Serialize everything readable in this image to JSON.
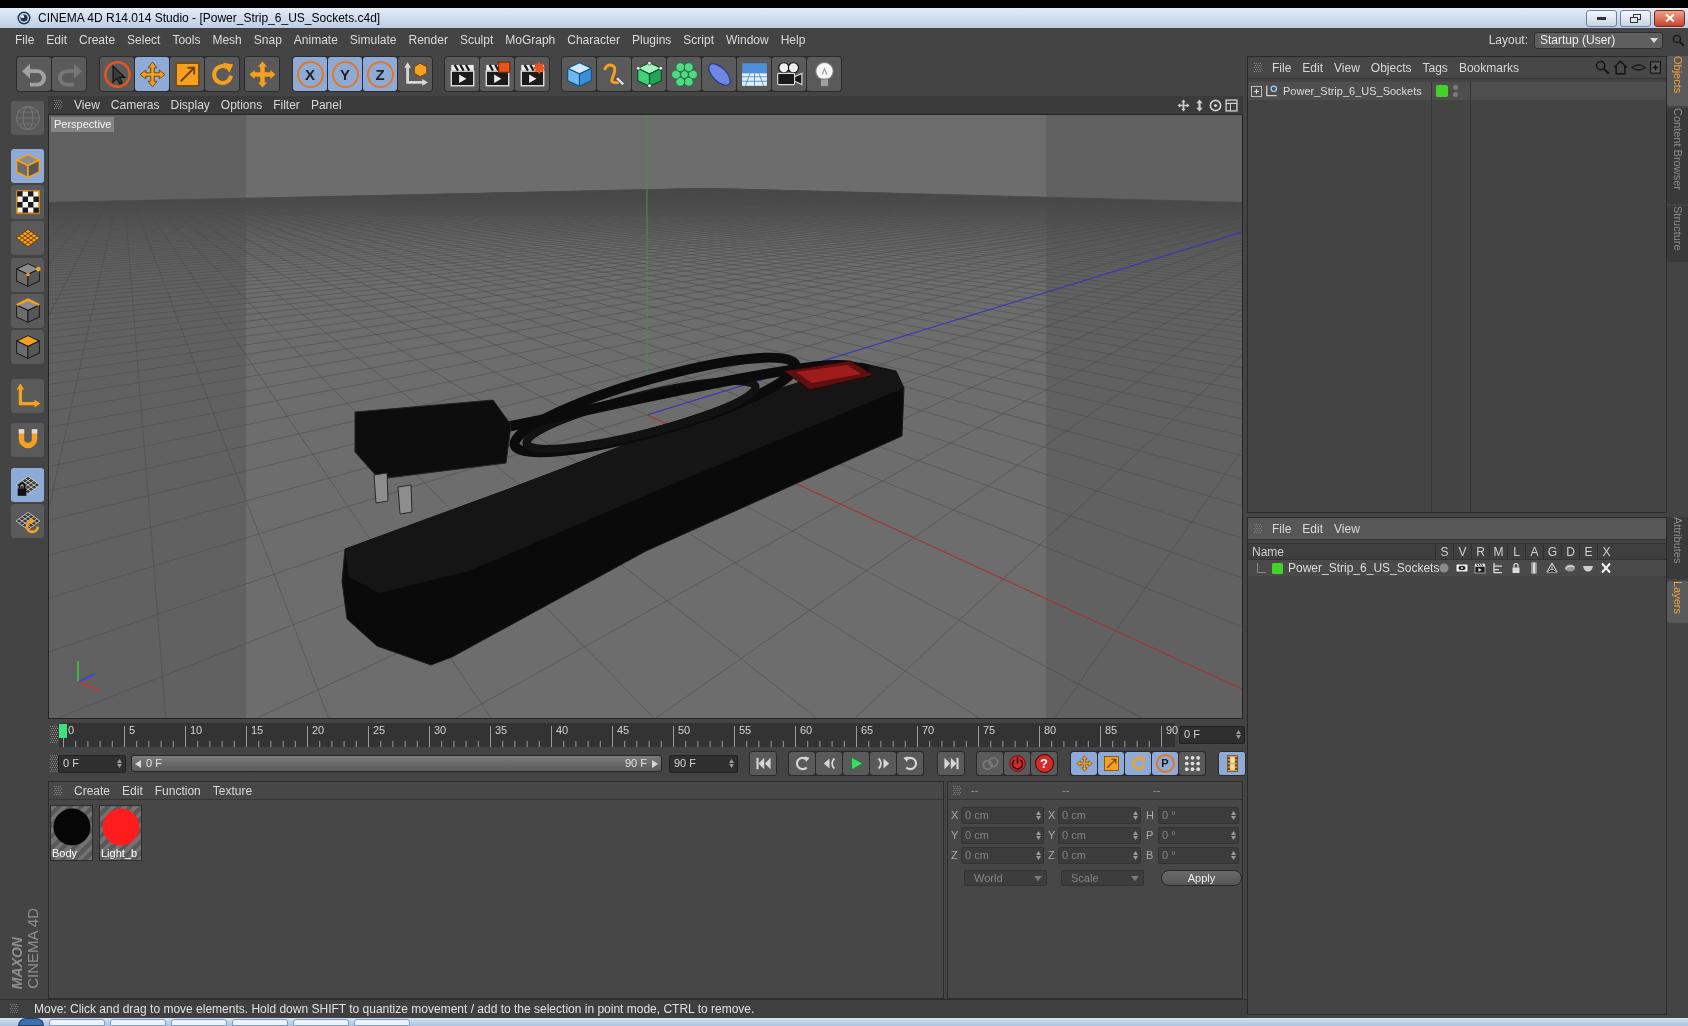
{
  "window": {
    "title": "CINEMA 4D R14.014 Studio - [Power_Strip_6_US_Sockets.c4d]"
  },
  "menu_bar": {
    "items": [
      "File",
      "Edit",
      "Create",
      "Select",
      "Tools",
      "Mesh",
      "Snap",
      "Animate",
      "Simulate",
      "Render",
      "Sculpt",
      "MoGraph",
      "Character",
      "Plugins",
      "Script",
      "Window",
      "Help"
    ],
    "layout_label": "Layout:",
    "layout_value": "Startup (User)"
  },
  "toolbar": {
    "groups": [
      [
        {
          "disabled": false
        },
        {
          "disabled": true
        }
      ],
      [
        {
          "selected": false
        },
        {
          "selected": true
        },
        {
          "selected": false
        },
        {
          "selected": false
        }
      ],
      [
        {
          "selected": false
        }
      ],
      [
        {
          "label": "X",
          "selected": true
        },
        {
          "label": "Y",
          "selected": true
        },
        {
          "label": "Z",
          "selected": true
        },
        {
          "selected": false
        }
      ],
      [
        {
          "selected": false
        },
        {
          "selected": false
        },
        {
          "selected": false
        }
      ],
      [
        {
          "selected": false
        },
        {
          "selected": false
        },
        {
          "selected": false
        },
        {
          "selected": false
        },
        {
          "selected": false
        },
        {
          "selected": false
        },
        {
          "selected": false
        },
        {
          "selected": false
        }
      ]
    ]
  },
  "left_toolbar": {
    "items": [
      {
        "selected": false,
        "disabled": true
      },
      {
        "selected": true,
        "disabled": false
      },
      {
        "selected": false,
        "disabled": false
      },
      {
        "selected": false,
        "disabled": false
      },
      {
        "selected": false,
        "disabled": false
      },
      {
        "selected": false,
        "disabled": false
      },
      {
        "selected": false,
        "disabled": false
      },
      {
        "selected": false,
        "disabled": false
      },
      {
        "selected": false,
        "disabled": false
      },
      {
        "selected": true,
        "disabled": false
      },
      {
        "selected": false,
        "disabled": false
      }
    ]
  },
  "viewport": {
    "menu": [
      "View",
      "Cameras",
      "Display",
      "Options",
      "Filter",
      "Panel"
    ],
    "camera": "Perspective"
  },
  "timeline": {
    "ticks": [
      "0",
      "5",
      "10",
      "15",
      "20",
      "25",
      "30",
      "35",
      "40",
      "45",
      "50",
      "55",
      "60",
      "65",
      "70",
      "75",
      "80",
      "85",
      "90"
    ],
    "playhead": {
      "level": 0
    },
    "current_frame": "0 F"
  },
  "transport": {
    "start_field": "0 F",
    "range": {
      "start": "0 F",
      "end": "90 F",
      "level": 1
    },
    "end_field": "90 F",
    "record": [
      {
        "disabled": true
      },
      {
        "disabled": false
      },
      {
        "disabled": false,
        "label": "?"
      }
    ],
    "key_modes": [
      {
        "selected": true
      },
      {
        "selected": true
      },
      {
        "selected": true
      },
      {
        "selected": true,
        "label": "P"
      },
      {
        "selected": false
      }
    ],
    "timeline_button": {
      "selected": true
    }
  },
  "materials": {
    "menu": [
      "Create",
      "Edit",
      "Function",
      "Texture"
    ],
    "items": [
      {
        "name": "Body",
        "color": "#060606"
      },
      {
        "name": "Light_b",
        "color": "#ff1c1c"
      }
    ]
  },
  "coordinates": {
    "headers": [
      "--",
      "--",
      "--"
    ],
    "disabled": true,
    "rows": [
      [
        {
          "axis": "X",
          "value": "0 cm"
        },
        {
          "axis": "X",
          "value": "0 cm"
        },
        {
          "axis": "H",
          "value": "0 °"
        }
      ],
      [
        {
          "axis": "Y",
          "value": "0 cm"
        },
        {
          "axis": "Y",
          "value": "0 cm"
        },
        {
          "axis": "P",
          "value": "0 °"
        }
      ],
      [
        {
          "axis": "Z",
          "value": "0 cm"
        },
        {
          "axis": "Z",
          "value": "0 cm"
        },
        {
          "axis": "B",
          "value": "0 °"
        }
      ]
    ],
    "dropdowns": [
      "World",
      "Scale"
    ],
    "apply": "Apply"
  },
  "objects": {
    "menu": [
      "File",
      "Edit",
      "View",
      "Objects",
      "Tags",
      "Bookmarks"
    ],
    "rows": [
      {
        "name": "Power_Strip_6_US_Sockets",
        "expanded": false,
        "color": "#44d22a"
      }
    ]
  },
  "side_tabs": {
    "upper": [
      {
        "label": "Objects",
        "selected": true
      },
      {
        "label": "Content Browser",
        "selected": false
      },
      {
        "label": "Structure",
        "selected": false
      }
    ],
    "lower": [
      {
        "label": "Attributes",
        "selected": false
      },
      {
        "label": "Layers",
        "selected": true
      }
    ]
  },
  "layers": {
    "menu": [
      "File",
      "Edit",
      "View"
    ],
    "columns": [
      "Name",
      "S",
      "V",
      "R",
      "M",
      "L",
      "A",
      "G",
      "D",
      "E",
      "X"
    ],
    "rows": [
      {
        "name": "Power_Strip_6_US_Sockets",
        "color": "#44d22a",
        "toggles": [
          {
            "on": false
          },
          {
            "on": true
          },
          {
            "on": true
          },
          {
            "on": true
          },
          {
            "on": true
          },
          {
            "on": true
          },
          {
            "on": true
          },
          {
            "on": true
          },
          {
            "on": true
          },
          {
            "on": true
          }
        ]
      }
    ]
  },
  "brand": {
    "maker": "MAXON",
    "product": "CINEMA 4D"
  },
  "status_bar": {
    "text": "Move: Click and drag to move elements. Hold down SHIFT to quantize movement / add to the selection in point mode, CTRL to remove."
  }
}
